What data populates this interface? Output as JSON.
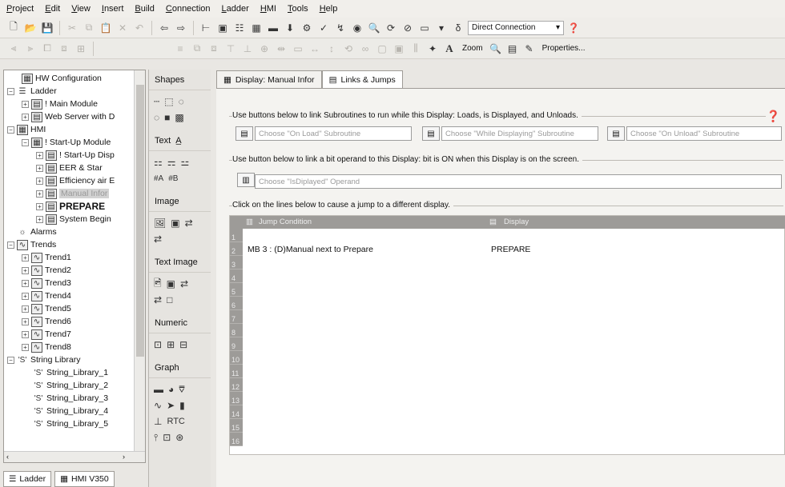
{
  "menu": [
    "Project",
    "Edit",
    "View",
    "Insert",
    "Build",
    "Connection",
    "Ladder",
    "HMI",
    "Tools",
    "Help"
  ],
  "toolbar": {
    "connection_value": "Direct Connection",
    "zoom_label": "Zoom",
    "properties_label": "Properties..."
  },
  "tree": {
    "items": [
      {
        "label": "HW Configuration"
      },
      {
        "label": "Ladder"
      },
      {
        "label": "! Main Module"
      },
      {
        "label": "Web Server with D"
      },
      {
        "label": "HMI"
      },
      {
        "label": "! Start-Up Module"
      },
      {
        "label": "! Start-Up Disp"
      },
      {
        "label": "EER & Star"
      },
      {
        "label": "Efficiency air E"
      },
      {
        "label": "Manual Infor"
      },
      {
        "label": "PREPARE"
      },
      {
        "label": "System Begin"
      },
      {
        "label": "Alarms"
      },
      {
        "label": "Trends"
      },
      {
        "label": "Trend1"
      },
      {
        "label": "Trend2"
      },
      {
        "label": "Trend3"
      },
      {
        "label": "Trend4"
      },
      {
        "label": "Trend5"
      },
      {
        "label": "Trend6"
      },
      {
        "label": "Trend7"
      },
      {
        "label": "Trend8"
      },
      {
        "label": "String Library"
      },
      {
        "label": "String_Library_1"
      },
      {
        "label": "String_Library_2"
      },
      {
        "label": "String_Library_3"
      },
      {
        "label": "String_Library_4"
      },
      {
        "label": "String_Library_5"
      }
    ]
  },
  "bottom_tabs": [
    "Ladder",
    "HMI V350"
  ],
  "shapes": {
    "title": "Shapes",
    "text": "Text",
    "image": "Image",
    "text_image": "Text Image",
    "numeric": "Numeric",
    "graph": "Graph",
    "rtc": "RTC"
  },
  "tabs": [
    "Display: Manual Infor",
    "Links & Jumps"
  ],
  "links": {
    "subroutines_label": "Use buttons below to link Subroutines to run while this Display:  Loads, is Displayed, and Unloads.",
    "on_load_placeholder": "Choose \"On Load\" Subroutine",
    "while_displaying_placeholder": "Choose \"While Displaying\" Subroutine",
    "on_unload_placeholder": "Choose \"On Unload\" Subroutine",
    "bit_label": "Use button below to link a bit operand to this Display: bit is ON when this Display is on the screen.",
    "isdisplayed_placeholder": "Choose \"IsDiplayed\" Operand",
    "jump_label": "Click on the lines below to cause a jump to a different display.",
    "col_condition": "Jump Condition",
    "col_display": "Display",
    "rows": [
      {
        "num": "1",
        "condition": "",
        "display": ""
      },
      {
        "num": "2",
        "condition": "MB 3 : (D)Manual next to Prepare",
        "display": "PREPARE"
      },
      {
        "num": "3",
        "condition": "",
        "display": ""
      },
      {
        "num": "4",
        "condition": "",
        "display": ""
      },
      {
        "num": "5",
        "condition": "",
        "display": ""
      },
      {
        "num": "6",
        "condition": "",
        "display": ""
      },
      {
        "num": "7",
        "condition": "",
        "display": ""
      },
      {
        "num": "8",
        "condition": "",
        "display": ""
      },
      {
        "num": "9",
        "condition": "",
        "display": ""
      },
      {
        "num": "10",
        "condition": "",
        "display": ""
      },
      {
        "num": "11",
        "condition": "",
        "display": ""
      },
      {
        "num": "12",
        "condition": "",
        "display": ""
      },
      {
        "num": "13",
        "condition": "",
        "display": ""
      },
      {
        "num": "14",
        "condition": "",
        "display": ""
      },
      {
        "num": "15",
        "condition": "",
        "display": ""
      },
      {
        "num": "16",
        "condition": "",
        "display": ""
      }
    ]
  }
}
